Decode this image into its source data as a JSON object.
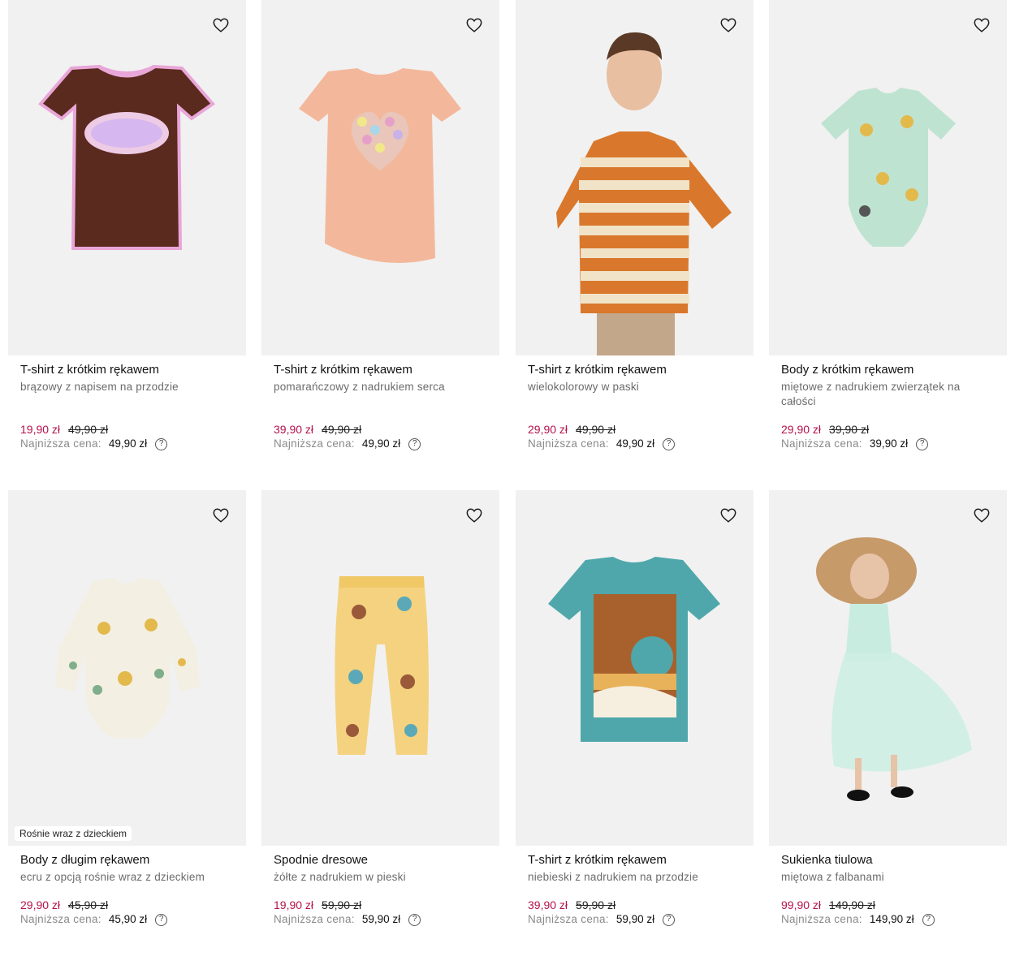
{
  "products": [
    {
      "title": "T-shirt z krótkim rękawem",
      "desc": "brązowy z napisem na przodzie",
      "sale": "19,90 zł",
      "old": "49,90 zł",
      "lowest_label": "Najniższa cena:",
      "lowest": "49,90 zł",
      "image": "brown-tshirt-stay-groovy",
      "icon": "heart-icon"
    },
    {
      "title": "T-shirt z krótkim rękawem",
      "desc": "pomarańczowy z nadrukiem serca",
      "sale": "39,90 zł",
      "old": "49,90 zł",
      "lowest_label": "Najniższa cena:",
      "lowest": "49,90 zł",
      "image": "peach-tshirt-heart",
      "icon": "heart-icon"
    },
    {
      "title": "T-shirt z krótkim rękawem",
      "desc": "wielokolorowy w paski",
      "sale": "29,90 zł",
      "old": "49,90 zł",
      "lowest_label": "Najniższa cena:",
      "lowest": "49,90 zł",
      "image": "boy-striped-tshirt",
      "icon": "heart-icon"
    },
    {
      "title": "Body z krótkim rękawem",
      "desc": "miętowe z nadrukiem zwierzątek na całości",
      "sale": "29,90 zł",
      "old": "39,90 zł",
      "lowest_label": "Najniższa cena:",
      "lowest": "39,90 zł",
      "image": "mint-bodysuit-animals",
      "icon": "heart-icon"
    },
    {
      "title": "Body z długim rękawem",
      "desc": "ecru z opcją rośnie wraz z dzieckiem",
      "sale": "29,90 zł",
      "old": "45,90 zł",
      "lowest_label": "Najniższa cena:",
      "lowest": "45,90 zł",
      "badge": "Rośnie wraz z dzieckiem",
      "image": "ecru-longsleeve-bodysuit",
      "icon": "heart-icon"
    },
    {
      "title": "Spodnie dresowe",
      "desc": "żółte z nadrukiem w pieski",
      "sale": "19,90 zł",
      "old": "59,90 zł",
      "lowest_label": "Najniższa cena:",
      "lowest": "59,90 zł",
      "image": "yellow-sweatpants-dogs",
      "icon": "heart-icon"
    },
    {
      "title": "T-shirt z krótkim rękawem",
      "desc": "niebieski z nadrukiem na przodzie",
      "sale": "39,90 zł",
      "old": "59,90 zł",
      "lowest_label": "Najniższa cena:",
      "lowest": "59,90 zł",
      "image": "blue-tshirt-ride-the-tide",
      "icon": "heart-icon"
    },
    {
      "title": "Sukienka tiulowa",
      "desc": "miętowa z falbanami",
      "sale": "99,90 zł",
      "old": "149,90 zł",
      "lowest_label": "Najniższa cena:",
      "lowest": "149,90 zł",
      "image": "girl-mint-tulle-dress",
      "icon": "heart-icon"
    }
  ],
  "colors": {
    "sale": "#b5124d",
    "image_bg": "#f1f1f1",
    "muted": "#8a8a8a"
  },
  "help_glyph": "?"
}
